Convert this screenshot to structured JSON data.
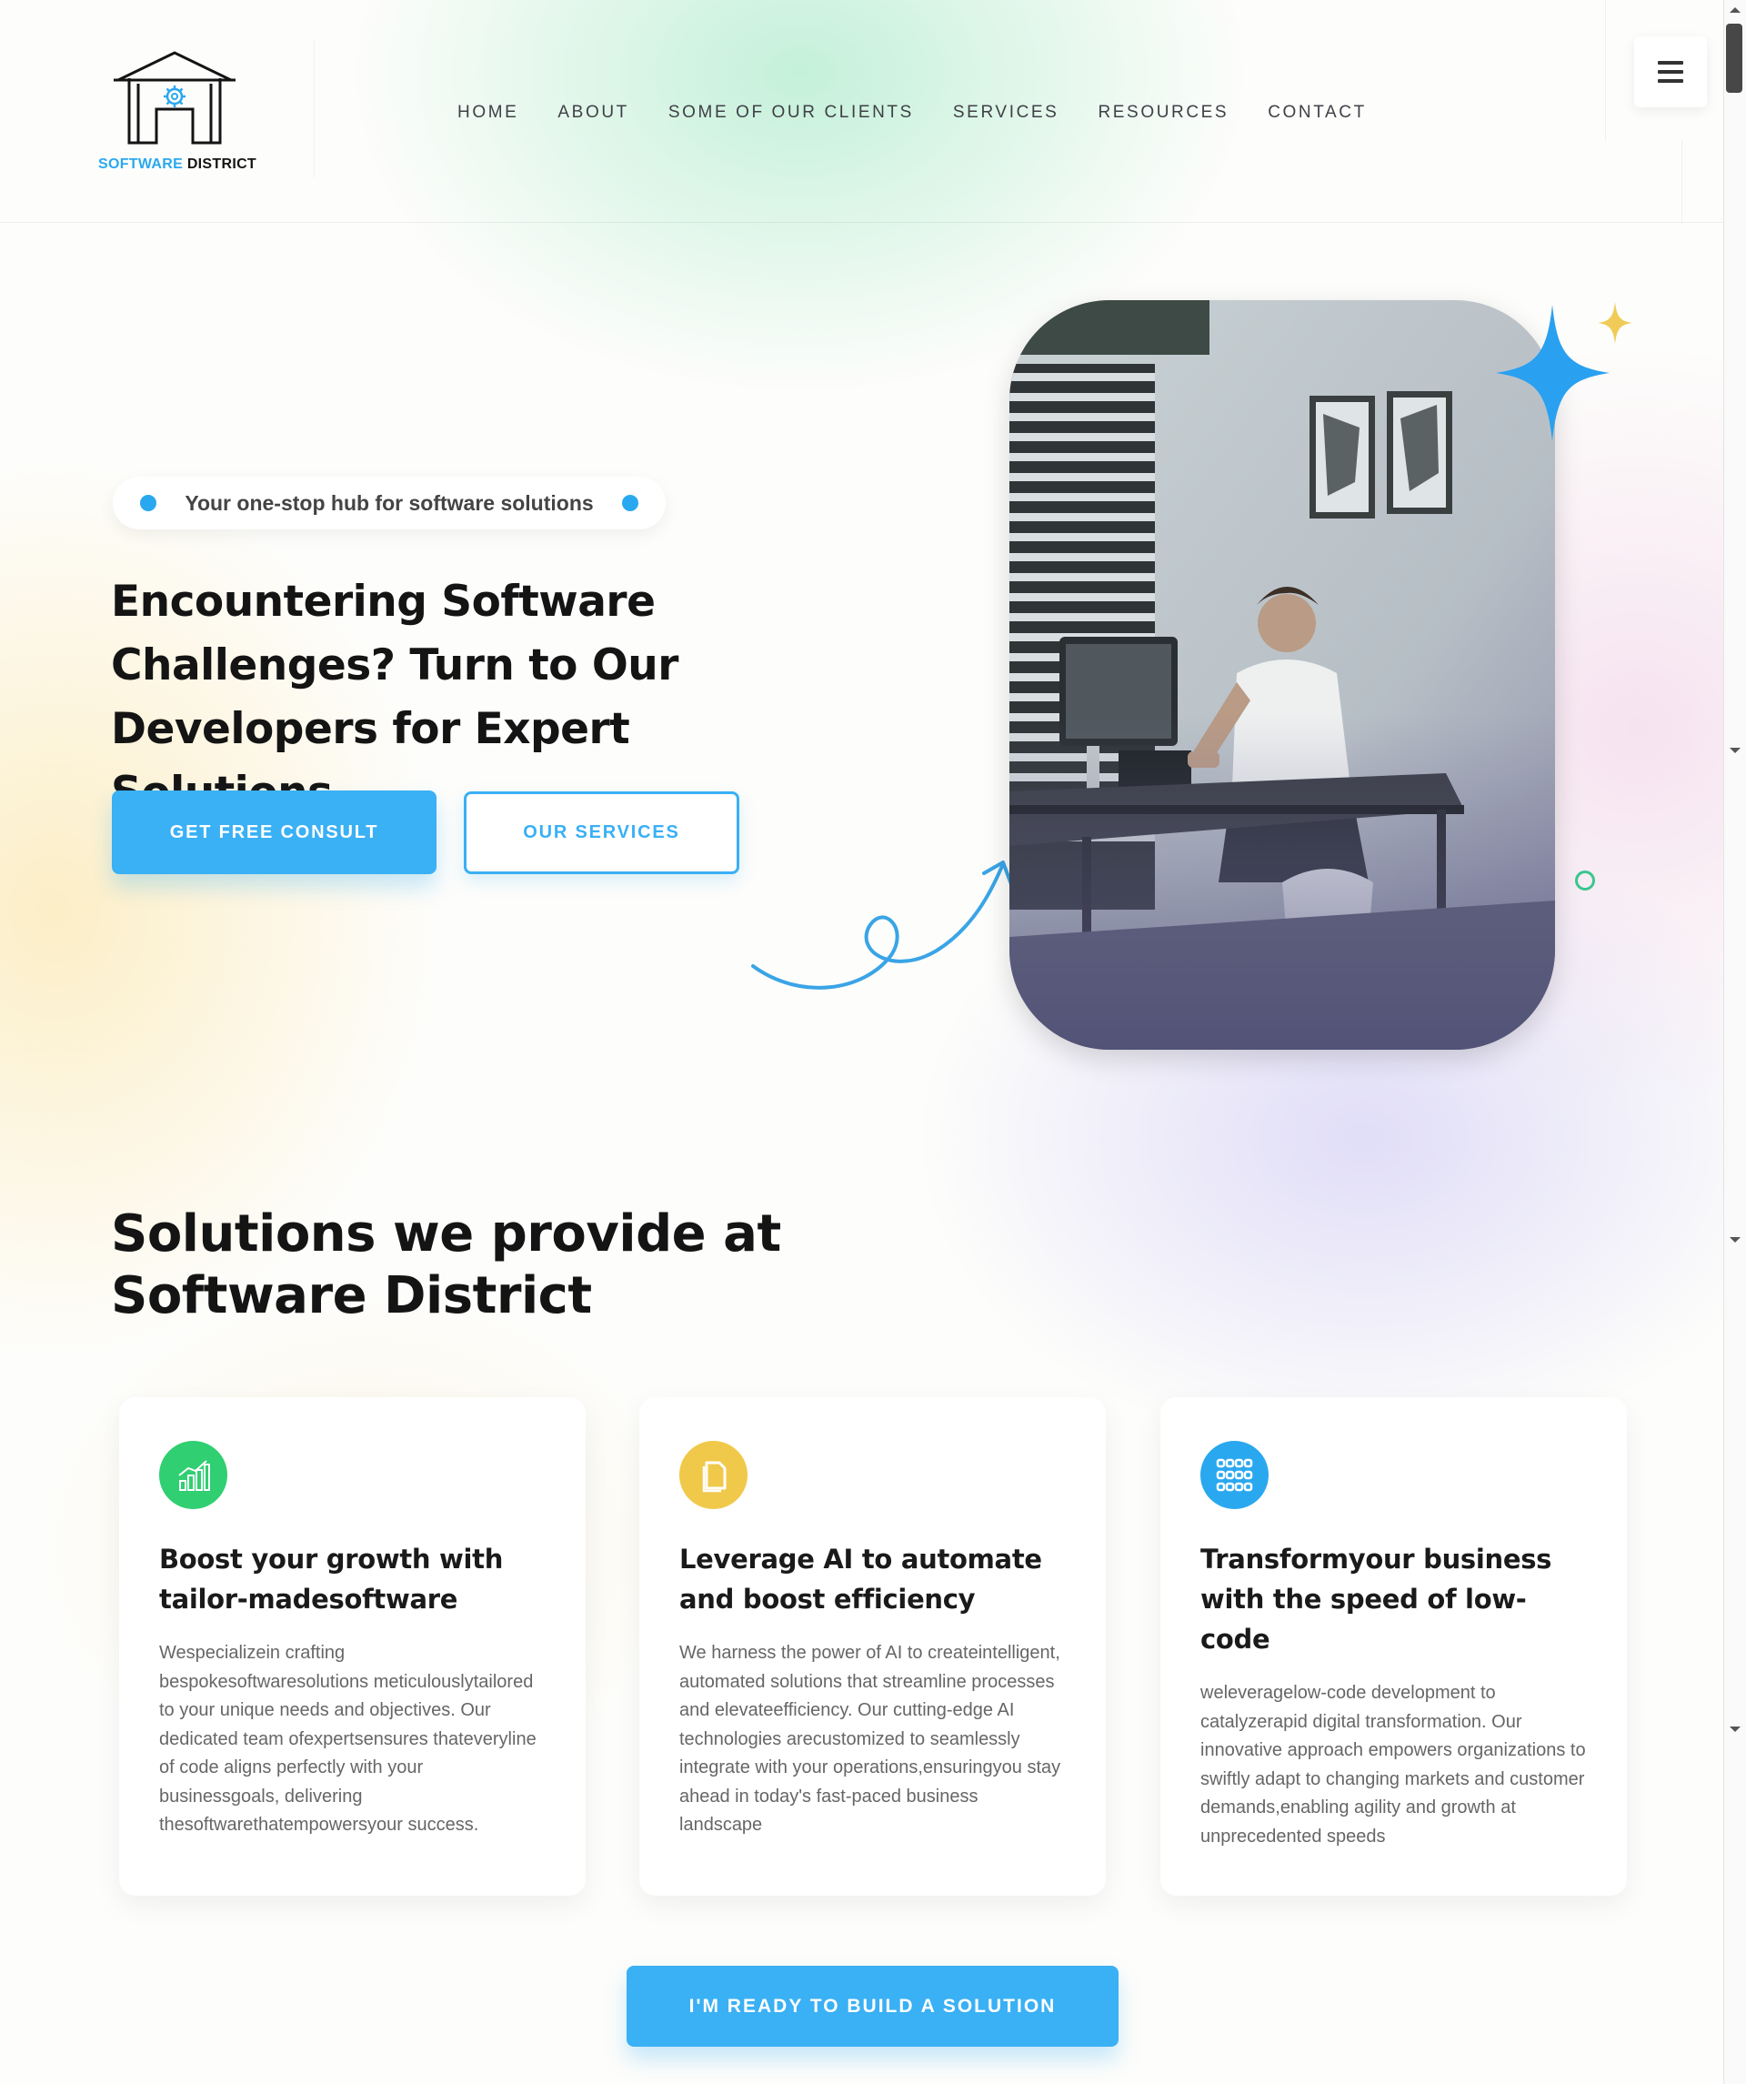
{
  "brand": {
    "name_part1": "SOFTWARE",
    "name_part2": "DISTRICT"
  },
  "nav": {
    "items": [
      {
        "label": "HOME"
      },
      {
        "label": "ABOUT"
      },
      {
        "label": "SOME OF OUR CLIENTS"
      },
      {
        "label": "SERVICES"
      },
      {
        "label": "RESOURCES"
      },
      {
        "label": "CONTACT"
      }
    ]
  },
  "hero": {
    "tagline": "Your one-stop hub for software solutions",
    "title": "Encountering Software Challenges? Turn to Our Developers for Expert Solutions",
    "primary_button": "GET FREE CONSULT",
    "secondary_button": "OUR SERVICES"
  },
  "solutions": {
    "title_line1": "Solutions we provide at",
    "title_line2": "Software District",
    "cards": [
      {
        "icon": "growth-chart-icon",
        "icon_color": "#2fcf72",
        "title": "Boost your growth with tailor-madesoftware",
        "body": "Wespecializein crafting bespokesoftwaresolutions meticulouslytailored to your unique needs and objectives. Our dedicated team ofexpertsensures thateveryline of code aligns perfectly with your businessgoals, delivering thesoftwarethatempowersyour success."
      },
      {
        "icon": "document-icon",
        "icon_color": "#f0c94a",
        "title": "Leverage AI to automate and boost efficiency",
        "body": "We harness the power of AI to createintelligent, automated solutions that streamline processes and elevateefficiency. Our cutting-edge AI technologies arecustomized to seamlessly integrate with your operations,ensuringyou stay ahead in today's fast-paced business landscape"
      },
      {
        "icon": "grid-icon",
        "icon_color": "#2aa8ef",
        "title": "Transformyour business with the speed of low-code",
        "body": "weleveragelow-code development to catalyzerapid digital transformation. Our innovative approach empowers organizations to swiftly adapt to changing markets and customer demands,enabling agility and growth at unprecedented speeds"
      }
    ],
    "cta_button": "I'M READY TO BUILD A SOLUTION"
  },
  "colors": {
    "accent": "#3ab0f5",
    "green": "#2fcf72",
    "yellow": "#f0c94a"
  }
}
